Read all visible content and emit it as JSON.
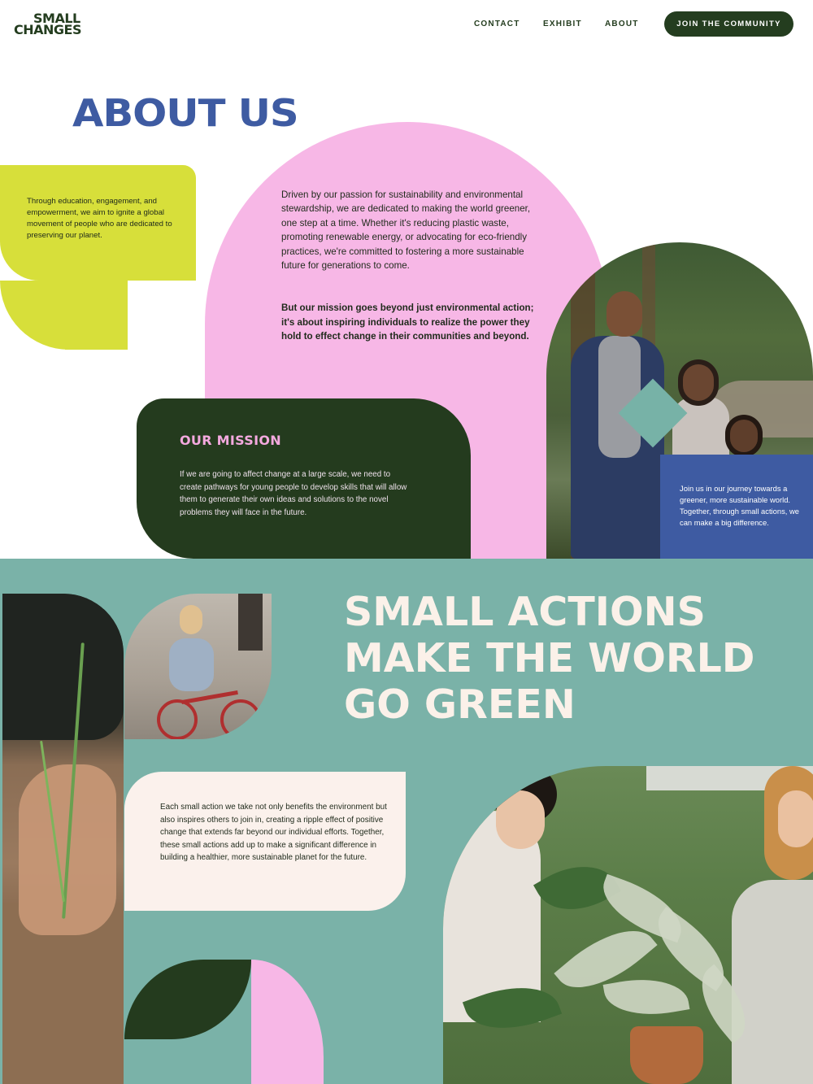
{
  "header": {
    "logo_line1": "SMALL",
    "logo_line2": "CHANGES",
    "nav": [
      "CONTACT",
      "EXHIBIT",
      "ABOUT"
    ],
    "cta_label": "JOIN THE COMMUNITY"
  },
  "about": {
    "title": "ABOUT US",
    "lime_text": "Through education, engagement, and empowerment, we aim to ignite a global movement of people who are dedicated to preserving our planet.",
    "pink_paragraph": "Driven by our passion for sustainability and environmental stewardship, we are dedicated to making the world greener, one step at a time. Whether it's reducing plastic waste, promoting renewable energy, or advocating for eco-friendly practices, we're committed to fostering a more sustainable future for generations to come.",
    "pink_bold": "But our mission goes beyond just environmental action; it's about inspiring individuals to realize the power they hold to effect change in their communities and beyond.",
    "mission_title": "OUR MISSION",
    "mission_text": "If we are going to affect change at a large scale, we need to create pathways for young people to develop skills that will allow them to generate their own ideas and solutions to the novel problems they will face in the future.",
    "blue_text": "Join us in our journey towards a greener, more sustainable world. Together, through small actions, we can make a big difference."
  },
  "actions": {
    "title": "SMALL ACTIONS MAKE THE WORLD GO GREEN",
    "body": "Each small action we take not only benefits the environment but also inspires others to join in, creating a ripple effect of positive change that extends far beyond our individual efforts. Together, these small actions add up to make a significant difference in building a healthier, more sustainable planet for the future."
  },
  "colors": {
    "brand_dark_green": "#243b1e",
    "brand_blue": "#3e5ba2",
    "pink": "#f7b7e6",
    "lime": "#d7df3a",
    "teal": "#7ab2a8",
    "cream": "#fbf1ec"
  },
  "images": [
    "forest-group-photo",
    "planting-sprout-photo",
    "woman-on-bike-photo",
    "potting-plants-photo"
  ]
}
